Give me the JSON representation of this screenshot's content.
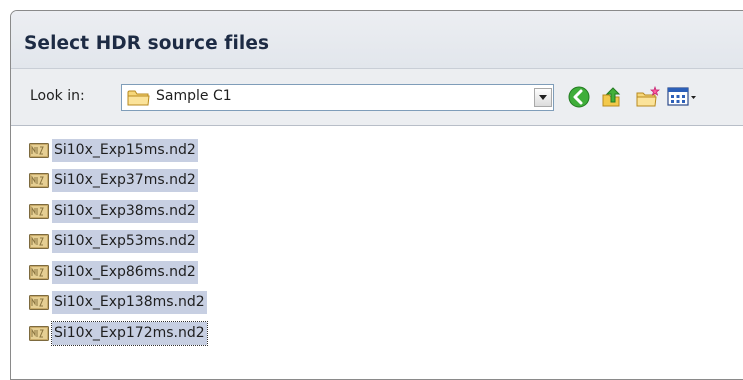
{
  "dialog": {
    "title": "Select HDR source files"
  },
  "toolbar": {
    "look_in_label": "Look in:",
    "look_in_value": "Sample C1",
    "icons": [
      "folder-icon",
      "back-icon",
      "up-folder-icon",
      "new-folder-icon",
      "view-menu-icon"
    ]
  },
  "files": [
    {
      "name": "Si10x_Exp15ms.nd2",
      "selected": true
    },
    {
      "name": "Si10x_Exp37ms.nd2",
      "selected": true
    },
    {
      "name": "Si10x_Exp38ms.nd2",
      "selected": true
    },
    {
      "name": "Si10x_Exp53ms.nd2",
      "selected": true
    },
    {
      "name": "Si10x_Exp86ms.nd2",
      "selected": true
    },
    {
      "name": "Si10x_Exp138ms.nd2",
      "selected": true
    },
    {
      "name": "Si10x_Exp172ms.nd2",
      "selected": true,
      "focused": true
    }
  ],
  "colors": {
    "selection": "#c7cfe2",
    "title_text": "#1d2b44"
  }
}
